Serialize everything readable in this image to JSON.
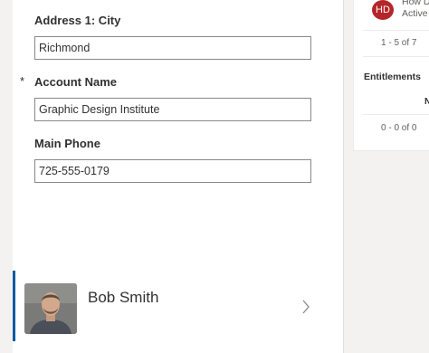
{
  "form": {
    "city": {
      "label": "Address 1: City",
      "value": "Richmond"
    },
    "account": {
      "label": "Account Name",
      "required_mark": "*",
      "value": "Graphic Design Institute"
    },
    "phone": {
      "label": "Main Phone",
      "value": "725-555-0179"
    }
  },
  "contact_card": {
    "name": "Bob Smith",
    "icon": "chevron-right-icon"
  },
  "right_panel": {
    "item": {
      "initials": "HD",
      "title": "How D",
      "status": "Active"
    },
    "pager": "1 - 5 of 7",
    "entitlements": {
      "title": "Entitlements",
      "column": "N",
      "pager": "0 - 0 of 0"
    }
  },
  "colors": {
    "accent": "#005a9e",
    "badge": "#b4262a",
    "border": "#8a8886"
  }
}
